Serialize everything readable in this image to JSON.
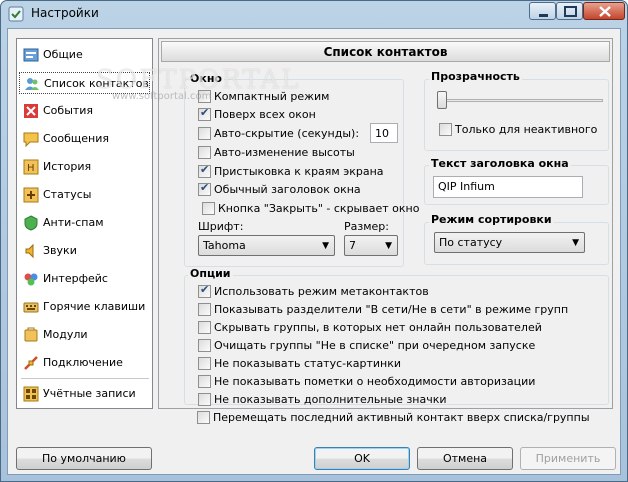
{
  "window": {
    "title": "Настройки"
  },
  "sidebar": {
    "items": [
      {
        "label": "Общие",
        "icon": "general-icon"
      },
      {
        "label": "Список контактов",
        "icon": "contact-list-icon"
      },
      {
        "label": "События",
        "icon": "events-icon"
      },
      {
        "label": "Сообщения",
        "icon": "messages-icon"
      },
      {
        "label": "История",
        "icon": "history-icon"
      },
      {
        "label": "Статусы",
        "icon": "statuses-icon"
      },
      {
        "label": "Анти-спам",
        "icon": "antispam-icon"
      },
      {
        "label": "Звуки",
        "icon": "sounds-icon"
      },
      {
        "label": "Интерфейс",
        "icon": "interface-icon"
      },
      {
        "label": "Горячие клавиши",
        "icon": "hotkeys-icon"
      },
      {
        "label": "Модули",
        "icon": "modules-icon"
      },
      {
        "label": "Подключение",
        "icon": "connection-icon"
      },
      {
        "label": "Учётные записи",
        "icon": "accounts-icon"
      }
    ],
    "selected_index": 1
  },
  "panel": {
    "title": "Список контактов"
  },
  "window_group": {
    "title": "Окно",
    "compact": {
      "label": "Компактный режим",
      "checked": false
    },
    "on_top": {
      "label": "Поверх всех окон",
      "checked": true
    },
    "autohide": {
      "label": "Авто-скрытие (секунды):",
      "checked": false,
      "value": "10"
    },
    "autoheight": {
      "label": "Авто-изменение высоты",
      "checked": false
    },
    "dock": {
      "label": "Пристыковка к краям экрана",
      "checked": true
    },
    "normal_title": {
      "label": "Обычный заголовок окна",
      "checked": true
    },
    "close_hides": {
      "label": "Кнопка \"Закрыть\" - скрывает окно",
      "checked": false
    },
    "font_label": "Шрифт:",
    "font_value": "Tahoma",
    "size_label": "Размер:",
    "size_value": "7"
  },
  "transparency": {
    "title": "Прозрачность",
    "level": 0,
    "inactive_only": {
      "label": "Только для неактивного",
      "checked": false
    }
  },
  "caption_text": {
    "title": "Текст заголовка окна",
    "value": "QIP Infium"
  },
  "sort_mode": {
    "title": "Режим сортировки",
    "value": "По статусу"
  },
  "options": {
    "title": "Опции",
    "items": [
      {
        "label": "Использовать режим метаконтактов",
        "checked": true
      },
      {
        "label": "Показывать разделители \"В сети/Не в сети\" в режиме групп",
        "checked": false
      },
      {
        "label": "Скрывать группы, в которых нет онлайн пользователей",
        "checked": false
      },
      {
        "label": "Очищать группы \"Не в списке\" при очередном запуске",
        "checked": false
      },
      {
        "label": "Не показывать статус-картинки",
        "checked": false
      },
      {
        "label": "Не показывать пометки о необходимости авторизации",
        "checked": false
      },
      {
        "label": "Не показывать дополнительные значки",
        "checked": false
      },
      {
        "label": "Перемещать последний активный контакт вверх списка/группы",
        "checked": false
      }
    ]
  },
  "buttons": {
    "defaults": "По умолчанию",
    "ok": "OK",
    "cancel": "Отмена",
    "apply": "Применить"
  },
  "watermark": {
    "big": "SOFTPORTAL",
    "small": "www.softportal.com"
  },
  "colors": {
    "title_bar": "#bcd3e6",
    "close_button": "#c4452b",
    "check_mark": "#2a4d7a"
  }
}
